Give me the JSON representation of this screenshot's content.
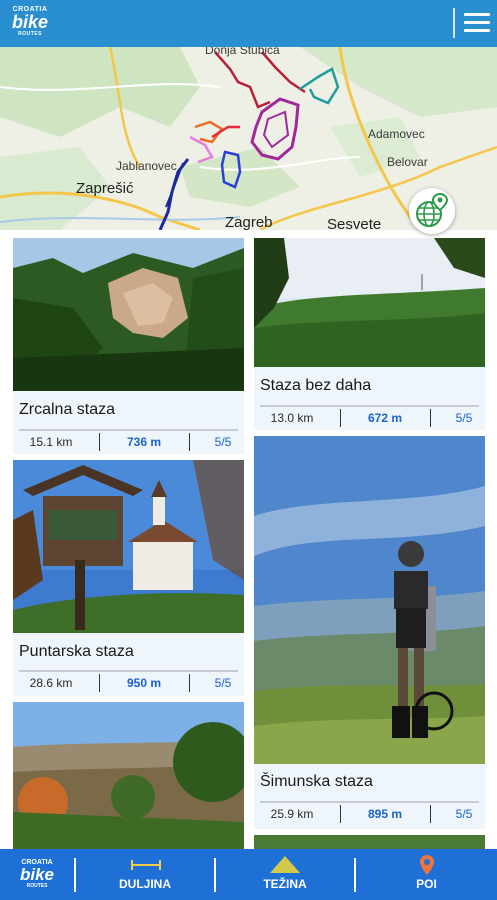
{
  "header": {
    "logo": {
      "line1": "CROATIA",
      "line2": "bike",
      "line3": "ROUTES"
    },
    "menu_icon": "hamburger-menu-icon"
  },
  "map": {
    "labels": {
      "top": "Donja Stubica",
      "adamovec": "Adamovec",
      "belovar": "Belovar",
      "jablanovec": "Jablanovec",
      "zapresic": "Zaprešić",
      "zagreb": "Zagreb",
      "sesvete": "Sesvete"
    },
    "location_button_icon": "globe-location-icon"
  },
  "routes": [
    {
      "name": "Zrcalna staza",
      "length": "15.1 km",
      "elevation": "736 m",
      "difficulty": "5/5"
    },
    {
      "name": "Staza bez daha",
      "length": "13.0 km",
      "elevation": "672 m",
      "difficulty": "5/5"
    },
    {
      "name": "Puntarska staza",
      "length": "28.6 km",
      "elevation": "950 m",
      "difficulty": "5/5"
    },
    {
      "name": "Šimunska staza",
      "length": "25.9 km",
      "elevation": "895 m",
      "difficulty": "5/5"
    }
  ],
  "bottom_nav": {
    "logo": {
      "line1": "CROATIA",
      "line2": "bike",
      "line3": "ROUTES"
    },
    "items": [
      {
        "label": "DULJINA",
        "icon": "length-ruler-icon"
      },
      {
        "label": "TEŽINA",
        "icon": "mountain-icon"
      },
      {
        "label": "POI",
        "icon": "map-pin-icon"
      }
    ]
  },
  "colors": {
    "header_bg": "#2a8fd0",
    "bottom_nav_bg": "#1e6fd6",
    "card_bg": "#eef5fb",
    "stat_accent": "#1a62c9"
  }
}
